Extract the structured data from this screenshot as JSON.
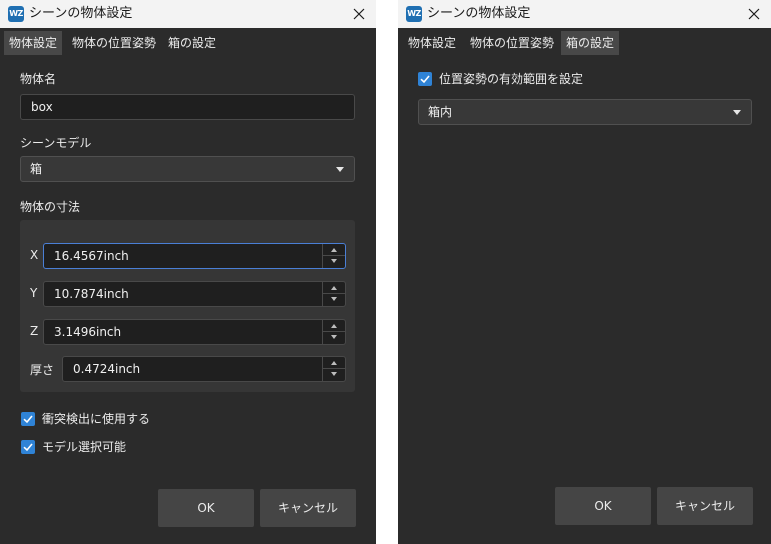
{
  "colors": {
    "dialog_bg": "#2b2b2b",
    "titlebar_bg": "#f3f3f3",
    "active_tab": "#484848",
    "checkbox_accent": "#2f83d6",
    "focus_border": "#4a7fd6",
    "button_bg": "#454545"
  },
  "dialog1": {
    "title": "シーンの物体設定",
    "tabs": [
      {
        "label": "物体設定",
        "active": true
      },
      {
        "label": "物体の位置姿勢",
        "active": false
      },
      {
        "label": "箱の設定",
        "active": false
      }
    ],
    "object_name": {
      "label": "物体名",
      "value": "box"
    },
    "scene_model": {
      "label": "シーンモデル",
      "selected": "箱"
    },
    "dimensions": {
      "label": "物体の寸法",
      "fields": [
        {
          "axis": "X",
          "value": "16.4567inch",
          "focused": true
        },
        {
          "axis": "Y",
          "value": "10.7874inch",
          "focused": false
        },
        {
          "axis": "Z",
          "value": "3.1496inch",
          "focused": false
        },
        {
          "axis": "厚さ",
          "value": "0.4724inch",
          "focused": false
        }
      ]
    },
    "checkboxes": [
      {
        "label": "衝突検出に使用する",
        "checked": true
      },
      {
        "label": "モデル選択可能",
        "checked": true
      }
    ],
    "ok_label": "OK",
    "cancel_label": "キャンセル"
  },
  "dialog2": {
    "title": "シーンの物体設定",
    "tabs": [
      {
        "label": "物体設定",
        "active": false
      },
      {
        "label": "物体の位置姿勢",
        "active": false
      },
      {
        "label": "箱の設定",
        "active": true
      }
    ],
    "pose_range_checkbox": {
      "label": "位置姿勢の有効範囲を設定",
      "checked": true
    },
    "range_select": {
      "selected": "箱内"
    },
    "ok_label": "OK",
    "cancel_label": "キャンセル"
  }
}
